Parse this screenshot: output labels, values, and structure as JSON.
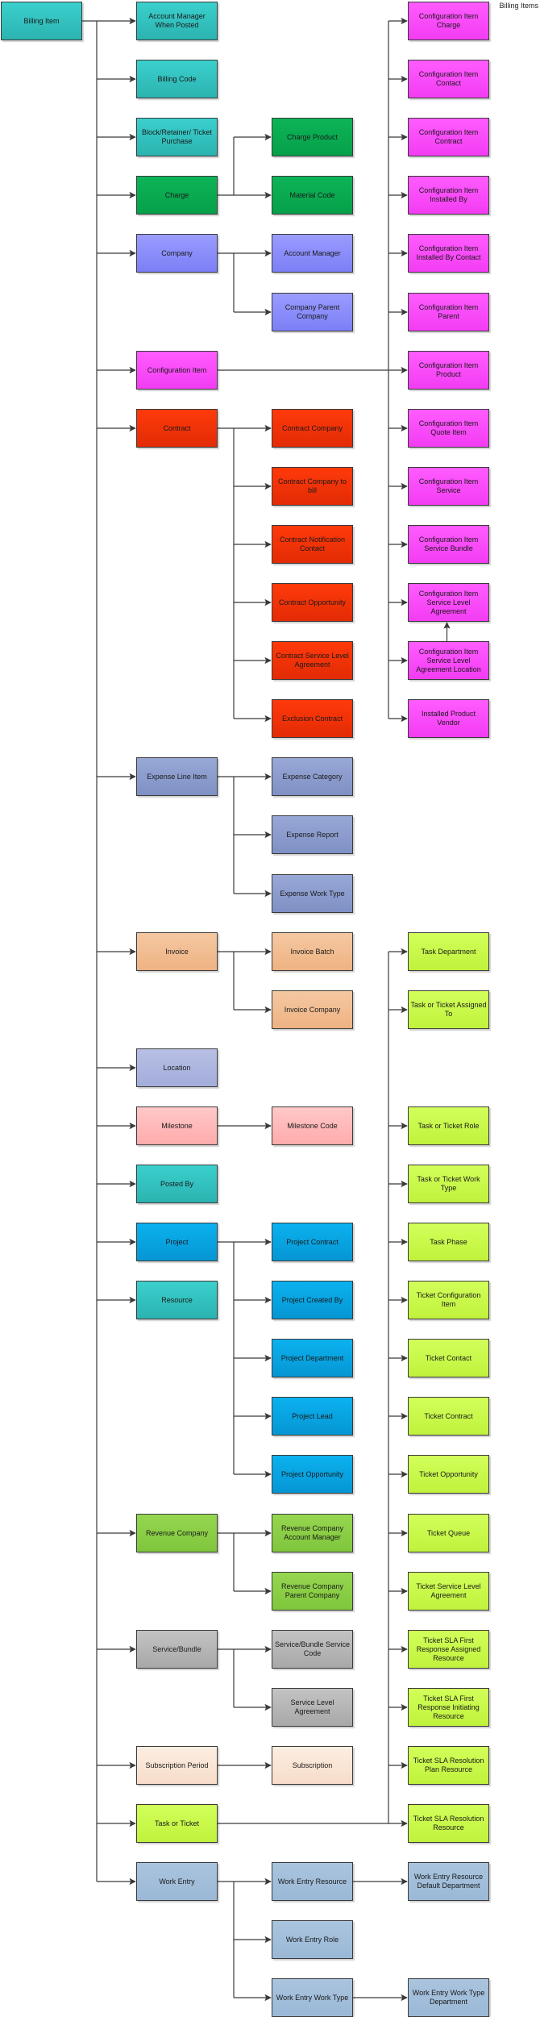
{
  "title": "Billing Items",
  "colors": {
    "connector": "#3a3a3a"
  },
  "nodes": [
    {
      "id": "billing-item",
      "label": "Billing Item",
      "col": 0,
      "row": 0,
      "style": "teal"
    },
    {
      "id": "account-manager-when-posted",
      "label": "Account Manager When Posted",
      "col": 1,
      "row": 0,
      "style": "teal",
      "parent": "billing-item"
    },
    {
      "id": "billing-code",
      "label": "Billing Code",
      "col": 1,
      "row": 1,
      "style": "teal",
      "parent": "billing-item"
    },
    {
      "id": "block-retainer-ticket-purchase",
      "label": "Block/Retainer/ Ticket Purchase",
      "col": 1,
      "row": 2,
      "style": "teal",
      "parent": "billing-item"
    },
    {
      "id": "charge",
      "label": "Charge",
      "col": 1,
      "row": 3,
      "style": "green",
      "parent": "billing-item"
    },
    {
      "id": "company",
      "label": "Company",
      "col": 1,
      "row": 4,
      "style": "violet",
      "parent": "billing-item"
    },
    {
      "id": "configuration-item",
      "label": "Configuration Item",
      "col": 1,
      "row": 6,
      "style": "magenta",
      "parent": "billing-item"
    },
    {
      "id": "contract",
      "label": "Contract",
      "col": 1,
      "row": 7,
      "style": "red",
      "parent": "billing-item"
    },
    {
      "id": "expense-line-item",
      "label": "Expense Line Item",
      "col": 1,
      "row": 13,
      "style": "steel",
      "parent": "billing-item"
    },
    {
      "id": "invoice",
      "label": "Invoice",
      "col": 1,
      "row": 16,
      "style": "peach",
      "parent": "billing-item"
    },
    {
      "id": "location",
      "label": "Location",
      "col": 1,
      "row": 18,
      "style": "lavender",
      "parent": "billing-item"
    },
    {
      "id": "milestone",
      "label": "Milestone",
      "col": 1,
      "row": 19,
      "style": "pink",
      "parent": "billing-item"
    },
    {
      "id": "posted-by",
      "label": "Posted By",
      "col": 1,
      "row": 20,
      "style": "teal",
      "parent": "billing-item"
    },
    {
      "id": "project",
      "label": "Project",
      "col": 1,
      "row": 21,
      "style": "cyan",
      "parent": "billing-item"
    },
    {
      "id": "resource",
      "label": "Resource",
      "col": 1,
      "row": 22,
      "style": "teal",
      "parent": "billing-item"
    },
    {
      "id": "revenue-company",
      "label": "Revenue Company",
      "col": 1,
      "row": 26,
      "style": "leaf",
      "parent": "billing-item"
    },
    {
      "id": "service-bundle",
      "label": "Service/Bundle",
      "col": 1,
      "row": 28,
      "style": "gray",
      "parent": "billing-item"
    },
    {
      "id": "subscription-period",
      "label": "Subscription Period",
      "col": 1,
      "row": 30,
      "style": "cream",
      "parent": "billing-item"
    },
    {
      "id": "task-or-ticket",
      "label": "Task or Ticket",
      "col": 1,
      "row": 31,
      "style": "lime",
      "parent": "billing-item"
    },
    {
      "id": "work-entry",
      "label": "Work Entry",
      "col": 1,
      "row": 32,
      "style": "slate",
      "parent": "billing-item"
    },
    {
      "id": "charge-product",
      "label": "Charge Product",
      "col": 2,
      "row": 2,
      "style": "green",
      "parent": "charge"
    },
    {
      "id": "material-code",
      "label": "Material Code",
      "col": 2,
      "row": 3,
      "style": "green",
      "parent": "charge"
    },
    {
      "id": "account-manager",
      "label": "Account Manager",
      "col": 2,
      "row": 4,
      "style": "violet",
      "parent": "company"
    },
    {
      "id": "company-parent-company",
      "label": "Company Parent Company",
      "col": 2,
      "row": 5,
      "style": "violet",
      "parent": "company"
    },
    {
      "id": "contract-company",
      "label": "Contract Company",
      "col": 2,
      "row": 7,
      "style": "red",
      "parent": "contract"
    },
    {
      "id": "contract-company-to-bill",
      "label": "Contract Company to bill",
      "col": 2,
      "row": 8,
      "style": "red",
      "parent": "contract"
    },
    {
      "id": "contract-notification-contact",
      "label": "Contract Notification Contact",
      "col": 2,
      "row": 9,
      "style": "red",
      "parent": "contract"
    },
    {
      "id": "contract-opportunity",
      "label": "Contract Opportunity",
      "col": 2,
      "row": 10,
      "style": "red",
      "parent": "contract"
    },
    {
      "id": "contract-service-level-agreement",
      "label": "Contract Service Level Agreement",
      "col": 2,
      "row": 11,
      "style": "red",
      "parent": "contract"
    },
    {
      "id": "exclusion-contract",
      "label": "Exclusion Contract",
      "col": 2,
      "row": 12,
      "style": "red",
      "parent": "contract"
    },
    {
      "id": "expense-category",
      "label": "Expense Category",
      "col": 2,
      "row": 13,
      "style": "steel",
      "parent": "expense-line-item"
    },
    {
      "id": "expense-report",
      "label": "Expense Report",
      "col": 2,
      "row": 14,
      "style": "steel",
      "parent": "expense-line-item"
    },
    {
      "id": "expense-work-type",
      "label": "Expense Work Type",
      "col": 2,
      "row": 15,
      "style": "steel",
      "parent": "expense-line-item"
    },
    {
      "id": "invoice-batch",
      "label": "Invoice Batch",
      "col": 2,
      "row": 16,
      "style": "peach",
      "parent": "invoice"
    },
    {
      "id": "invoice-company",
      "label": "Invoice Company",
      "col": 2,
      "row": 17,
      "style": "peach",
      "parent": "invoice"
    },
    {
      "id": "milestone-code",
      "label": "Milestone Code",
      "col": 2,
      "row": 19,
      "style": "pink",
      "parent": "milestone"
    },
    {
      "id": "project-contract",
      "label": "Project Contract",
      "col": 2,
      "row": 21,
      "style": "cyan",
      "parent": "project"
    },
    {
      "id": "project-created-by",
      "label": "Project Created By",
      "col": 2,
      "row": 22,
      "style": "cyan",
      "parent": "project"
    },
    {
      "id": "project-department",
      "label": "Project Department",
      "col": 2,
      "row": 23,
      "style": "cyan",
      "parent": "project"
    },
    {
      "id": "project-lead",
      "label": "Project Lead",
      "col": 2,
      "row": 24,
      "style": "cyan",
      "parent": "project"
    },
    {
      "id": "project-opportunity",
      "label": "Project Opportunity",
      "col": 2,
      "row": 25,
      "style": "cyan",
      "parent": "project"
    },
    {
      "id": "revenue-company-account-manager",
      "label": "Revenue Company Account Manager",
      "col": 2,
      "row": 26,
      "style": "leaf",
      "parent": "revenue-company"
    },
    {
      "id": "revenue-company-parent-company",
      "label": "Revenue Company Parent Company",
      "col": 2,
      "row": 27,
      "style": "leaf",
      "parent": "revenue-company"
    },
    {
      "id": "service-bundle-service-code",
      "label": "Service/Bundle Service Code",
      "col": 2,
      "row": 28,
      "style": "gray",
      "parent": "service-bundle"
    },
    {
      "id": "service-level-agreement",
      "label": "Service Level Agreement",
      "col": 2,
      "row": 29,
      "style": "gray",
      "parent": "service-bundle"
    },
    {
      "id": "subscription",
      "label": "Subscription",
      "col": 2,
      "row": 30,
      "style": "cream",
      "parent": "subscription-period"
    },
    {
      "id": "work-entry-resource",
      "label": "Work Entry Resource",
      "col": 2,
      "row": 32,
      "style": "slate",
      "parent": "work-entry"
    },
    {
      "id": "work-entry-role",
      "label": "Work Entry Role",
      "col": 2,
      "row": 33,
      "style": "slate",
      "parent": "work-entry"
    },
    {
      "id": "work-entry-work-type",
      "label": "Work Entry Work Type",
      "col": 2,
      "row": 34,
      "style": "slate",
      "parent": "work-entry"
    },
    {
      "id": "ci-charge",
      "label": "Configuration Item Charge",
      "col": 3,
      "row": 0,
      "style": "magenta",
      "parent": "configuration-item"
    },
    {
      "id": "ci-contact",
      "label": "Configuration Item Contact",
      "col": 3,
      "row": 1,
      "style": "magenta",
      "parent": "configuration-item"
    },
    {
      "id": "ci-contract",
      "label": "Configuration Item Contract",
      "col": 3,
      "row": 2,
      "style": "magenta",
      "parent": "configuration-item"
    },
    {
      "id": "ci-installed-by",
      "label": "Configuration Item Installed By",
      "col": 3,
      "row": 3,
      "style": "magenta",
      "parent": "configuration-item"
    },
    {
      "id": "ci-installed-by-contact",
      "label": "Configuration Item Installed By Contact",
      "col": 3,
      "row": 4,
      "style": "magenta",
      "parent": "configuration-item"
    },
    {
      "id": "ci-parent",
      "label": "Configuration Item Parent",
      "col": 3,
      "row": 5,
      "style": "magenta",
      "parent": "configuration-item"
    },
    {
      "id": "ci-product",
      "label": "Configuration Item Product",
      "col": 3,
      "row": 6,
      "style": "magenta",
      "parent": "configuration-item"
    },
    {
      "id": "ci-quote-item",
      "label": "Configuration Item Quote Item",
      "col": 3,
      "row": 7,
      "style": "magenta",
      "parent": "configuration-item"
    },
    {
      "id": "ci-service",
      "label": "Configuration Item Service",
      "col": 3,
      "row": 8,
      "style": "magenta",
      "parent": "configuration-item"
    },
    {
      "id": "ci-service-bundle",
      "label": "Configuration Item Service Bundle",
      "col": 3,
      "row": 9,
      "style": "magenta",
      "parent": "configuration-item"
    },
    {
      "id": "ci-sla",
      "label": "Configuration Item Service Level Agreement",
      "col": 3,
      "row": 10,
      "style": "magenta",
      "parent": "configuration-item"
    },
    {
      "id": "ci-sla-location",
      "label": "Configuration Item Service Level Agreement Location",
      "col": 3,
      "row": 11,
      "style": "magenta",
      "parent": "configuration-item"
    },
    {
      "id": "installed-product-vendor",
      "label": "Installed Product Vendor",
      "col": 3,
      "row": 12,
      "style": "magenta",
      "parent": "configuration-item"
    },
    {
      "id": "task-department",
      "label": "Task Department",
      "col": 3,
      "row": 16,
      "style": "lime",
      "parent": "task-or-ticket"
    },
    {
      "id": "task-or-ticket-assigned-to",
      "label": "Task or Ticket Assigned To",
      "col": 3,
      "row": 17,
      "style": "lime",
      "parent": "task-or-ticket"
    },
    {
      "id": "task-or-ticket-role",
      "label": "Task or Ticket Role",
      "col": 3,
      "row": 19,
      "style": "lime",
      "parent": "task-or-ticket"
    },
    {
      "id": "task-or-ticket-work-type",
      "label": "Task or Ticket Work Type",
      "col": 3,
      "row": 20,
      "style": "lime",
      "parent": "task-or-ticket"
    },
    {
      "id": "task-phase",
      "label": "Task Phase",
      "col": 3,
      "row": 21,
      "style": "lime",
      "parent": "task-or-ticket"
    },
    {
      "id": "ticket-configuration-item",
      "label": "Ticket Configuration Item",
      "col": 3,
      "row": 22,
      "style": "lime",
      "parent": "task-or-ticket"
    },
    {
      "id": "ticket-contact",
      "label": "Ticket Contact",
      "col": 3,
      "row": 23,
      "style": "lime",
      "parent": "task-or-ticket"
    },
    {
      "id": "ticket-contract",
      "label": "Ticket Contract",
      "col": 3,
      "row": 24,
      "style": "lime",
      "parent": "task-or-ticket"
    },
    {
      "id": "ticket-opportunity",
      "label": "Ticket Opportunity",
      "col": 3,
      "row": 25,
      "style": "lime",
      "parent": "task-or-ticket"
    },
    {
      "id": "ticket-queue",
      "label": "Ticket Queue",
      "col": 3,
      "row": 26,
      "style": "lime",
      "parent": "task-or-ticket"
    },
    {
      "id": "ticket-service-level-agreement",
      "label": "Ticket Service Level Agreement",
      "col": 3,
      "row": 27,
      "style": "lime",
      "parent": "task-or-ticket"
    },
    {
      "id": "ticket-sla-first-response-assigned-resource",
      "label": "Ticket SLA First Response Assigned Resource",
      "col": 3,
      "row": 28,
      "style": "lime",
      "parent": "task-or-ticket"
    },
    {
      "id": "ticket-sla-first-response-initiating-resource",
      "label": "Ticket SLA First Response Initiating Resource",
      "col": 3,
      "row": 29,
      "style": "lime",
      "parent": "task-or-ticket"
    },
    {
      "id": "ticket-sla-resolution-plan-resource",
      "label": "Ticket SLA Resolution Plan Resource",
      "col": 3,
      "row": 30,
      "style": "lime",
      "parent": "task-or-ticket"
    },
    {
      "id": "ticket-sla-resolution-resource",
      "label": "Ticket SLA Resolution Resource",
      "col": 3,
      "row": 31,
      "style": "lime",
      "parent": "task-or-ticket"
    },
    {
      "id": "work-entry-resource-default-department",
      "label": "Work Entry Resource Default Department",
      "col": 3,
      "row": 32,
      "style": "slate",
      "parent": "work-entry-resource"
    },
    {
      "id": "work-entry-work-type-department",
      "label": "Work Entry Work Type Department",
      "col": 3,
      "row": 34,
      "style": "slate",
      "parent": "work-entry-work-type"
    }
  ],
  "extra_edges": [
    {
      "from": "ci-sla-location",
      "to": "ci-sla",
      "direction": "up"
    }
  ]
}
